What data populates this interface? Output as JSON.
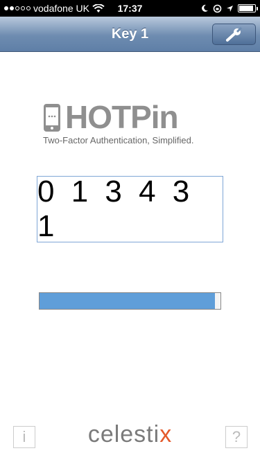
{
  "status_bar": {
    "carrier": "vodafone UK",
    "time": "17:37",
    "signal_bars_filled": 2,
    "signal_bars_total": 5,
    "battery_level": 0.9
  },
  "nav": {
    "title": "Key 1",
    "settings_icon": "wrench-icon"
  },
  "logo": {
    "title": "HOTPin",
    "tagline": "Two-Factor Authentication, Simplified."
  },
  "otp": {
    "code": "013431"
  },
  "progress": {
    "fraction": 0.97
  },
  "footer": {
    "info_label": "i",
    "help_label": "?",
    "brand_prefix": "celesti",
    "brand_suffix": "x"
  },
  "colors": {
    "nav_blue": "#6e8cb0",
    "progress_blue": "#5f9ed9",
    "brand_orange": "#e45a2b"
  }
}
